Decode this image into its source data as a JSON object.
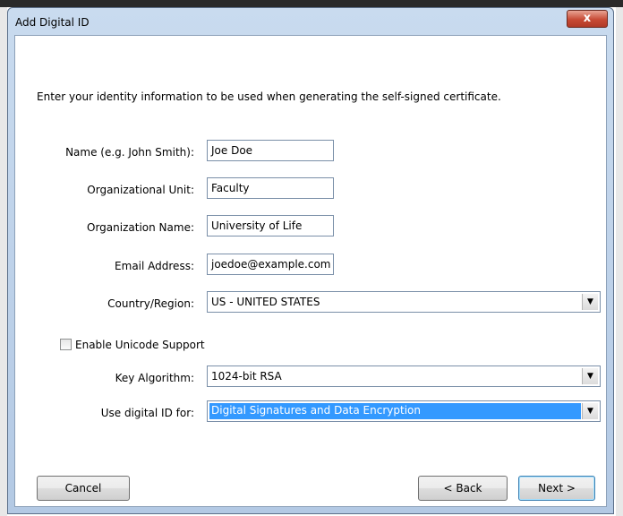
{
  "window": {
    "title": "Add Digital ID",
    "close_glyph": "x"
  },
  "intro_text": "Enter your identity information to be used when generating the self-signed certificate.",
  "fields": {
    "name": {
      "label": "Name (e.g. John Smith):",
      "value": "Joe Doe"
    },
    "org_unit": {
      "label": "Organizational Unit:",
      "value": "Faculty"
    },
    "org_name": {
      "label": "Organization Name:",
      "value": "University of Life"
    },
    "email": {
      "label": "Email Address:",
      "value": "joedoe@example.com"
    }
  },
  "country": {
    "label": "Country/Region:",
    "value": "US - UNITED STATES"
  },
  "unicode": {
    "label": "Enable Unicode Support",
    "checked": false
  },
  "key_algorithm": {
    "label": "Key Algorithm:",
    "value": "1024-bit RSA"
  },
  "use_for": {
    "label": "Use digital ID for:",
    "value": "Digital Signatures and Data Encryption"
  },
  "buttons": {
    "cancel": "Cancel",
    "back": "< Back",
    "next": "Next >"
  },
  "icons": {
    "dropdown": "chevron-down-icon",
    "close": "close-icon"
  },
  "colors": {
    "selection": "#3399ff",
    "close_button": "#c74a35",
    "title_bar": "#c9dbef"
  }
}
